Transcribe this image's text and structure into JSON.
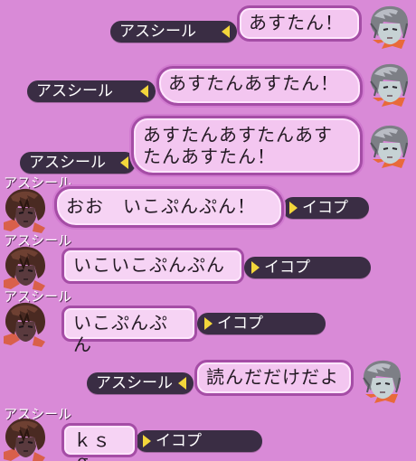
{
  "colors": {
    "background": "#d98ad7",
    "nametag": "#3a2d44",
    "nametag_marker": "#f3d63b",
    "bubble_fill": "#f3c6f0",
    "bubble_border": "#a54da6"
  },
  "messages": [
    {
      "side": "right",
      "sender": "アスシール",
      "text": "あすたん！",
      "avatar_icon": "silver-hair-character-avatar-icon"
    },
    {
      "side": "right",
      "sender": "アスシール",
      "text": "あすたんあすたん！",
      "avatar_icon": "silver-hair-character-avatar-icon"
    },
    {
      "side": "right",
      "sender": "アスシール",
      "text_lines": [
        "あすたんあすたんあす",
        "たんあすたん！"
      ],
      "avatar_icon": "silver-hair-character-avatar-icon"
    },
    {
      "side": "left",
      "header": "アスシール",
      "text": "おお　いこぷんぷん！",
      "recipient": "イコプ",
      "avatar_icon": "dark-hair-character-avatar-icon"
    },
    {
      "side": "left",
      "header": "アスシール",
      "text": "いこいこぷんぷん",
      "recipient": "イコプ",
      "avatar_icon": "dark-hair-character-avatar-icon"
    },
    {
      "side": "left",
      "header": "アスシール",
      "text": "いこぷんぷん",
      "recipient": "イコプ",
      "avatar_icon": "dark-hair-character-avatar-icon"
    },
    {
      "side": "right",
      "sender": "アスシール",
      "text": "読んだだけだよ",
      "avatar_icon": "silver-hair-character-avatar-icon"
    },
    {
      "side": "left",
      "header": "アスシール",
      "text": "ｋｓｇ",
      "recipient": "イコプ",
      "avatar_icon": "dark-hair-character-avatar-icon"
    }
  ]
}
